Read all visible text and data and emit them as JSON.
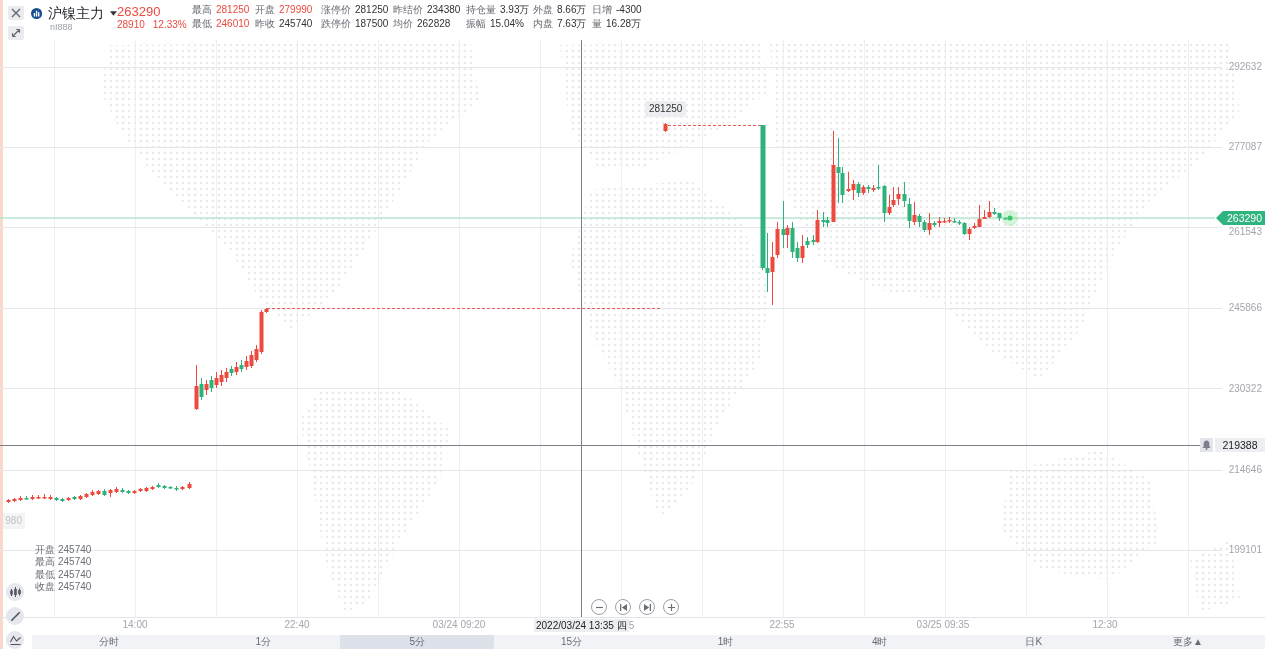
{
  "symbol": {
    "name": "沪镍主力",
    "code": "nI888"
  },
  "quote": {
    "price": "263290",
    "change": "28910",
    "change_percent": "12.33%",
    "rising": true
  },
  "stats": [
    [
      {
        "label": "最高",
        "value": "281250",
        "rising": true
      },
      {
        "label": "开盘",
        "value": "279990",
        "rising": true
      },
      {
        "label": "涨停价",
        "value": "281250",
        "rising": false
      },
      {
        "label": "昨结价",
        "value": "234380",
        "rising": false
      },
      {
        "label": "持仓量",
        "value": "3.93万",
        "rising": false
      },
      {
        "label": "外盘",
        "value": "8.66万",
        "rising": false
      },
      {
        "label": "日增",
        "value": "-4300",
        "rising": false
      }
    ],
    [
      {
        "label": "最低",
        "value": "246010",
        "rising": true
      },
      {
        "label": "昨收",
        "value": "245740",
        "rising": false
      },
      {
        "label": "跌停价",
        "value": "187500",
        "rising": false
      },
      {
        "label": "均价",
        "value": "262828",
        "rising": false
      },
      {
        "label": "振幅",
        "value": "15.04%",
        "rising": false
      },
      {
        "label": "内盘",
        "value": "7.63万",
        "rising": false
      },
      {
        "label": "量",
        "value": "16.28万",
        "rising": false
      }
    ]
  ],
  "chart": {
    "high_tooltip": "281250",
    "last_price": "263290",
    "price_axis": [
      "292632",
      "277087",
      "261543",
      "245866",
      "230322",
      "214646",
      "199101"
    ],
    "crosshair": {
      "price": "219388",
      "time": "2022/03/24 13:35 四"
    },
    "edge_price_label": "980",
    "ohlc": [
      {
        "label": "开盘",
        "value": "245740"
      },
      {
        "label": "最高",
        "value": "245740"
      },
      {
        "label": "最低",
        "value": "245740"
      },
      {
        "label": "收盘",
        "value": "245740"
      }
    ],
    "time_axis": [
      "14:00",
      "22:40",
      "03/24 09:20",
      "5",
      "22:55",
      "03/25 09:35",
      "12:30"
    ]
  },
  "timeframe_tabs": [
    {
      "label": "分时",
      "selected": false
    },
    {
      "label": "1分",
      "selected": false
    },
    {
      "label": "5分",
      "selected": true
    },
    {
      "label": "15分",
      "selected": false
    },
    {
      "label": "1时",
      "selected": false
    },
    {
      "label": "4时",
      "selected": false
    },
    {
      "label": "日K",
      "selected": false
    },
    {
      "label": "更多▲",
      "selected": false
    }
  ]
}
